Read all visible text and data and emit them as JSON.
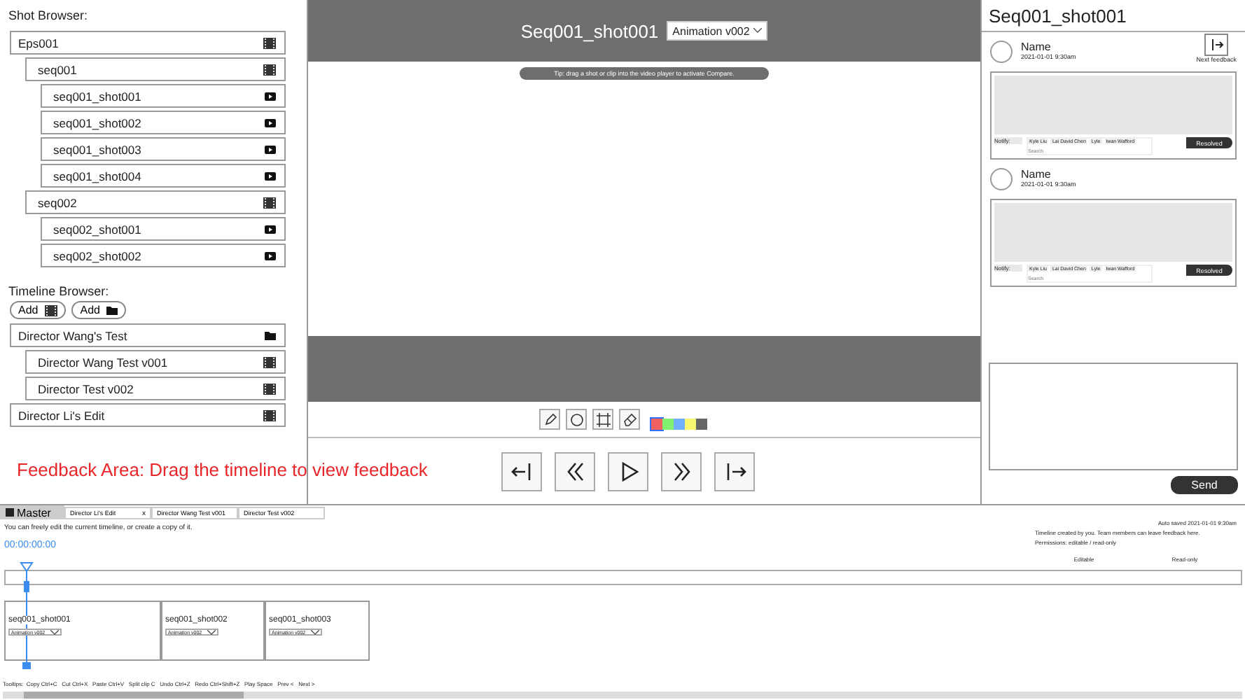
{
  "shot_browser": {
    "title": "Shot Browser:",
    "tree": [
      {
        "label": "Eps001",
        "kind": "sequence",
        "children": [
          {
            "label": "seq001",
            "kind": "sequence",
            "children": [
              {
                "label": "seq001_shot001",
                "kind": "shot"
              },
              {
                "label": "seq001_shot002",
                "kind": "shot"
              },
              {
                "label": "seq001_shot003",
                "kind": "shot"
              },
              {
                "label": "seq001_shot004",
                "kind": "shot"
              }
            ]
          },
          {
            "label": "seq002",
            "kind": "sequence",
            "children": [
              {
                "label": "seq002_shot001",
                "kind": "shot"
              },
              {
                "label": "seq002_shot002",
                "kind": "shot"
              }
            ]
          }
        ]
      }
    ]
  },
  "timeline_browser": {
    "title": "Timeline Browser:",
    "add_buttons": [
      {
        "label": "Add",
        "kind": "timeline"
      },
      {
        "label": "Add",
        "kind": "folder"
      }
    ],
    "tree": [
      {
        "label": "Director Wang's Test",
        "kind": "folder",
        "children": [
          {
            "label": "Director Wang Test v001",
            "kind": "sequence"
          },
          {
            "label": "Director Test v002",
            "kind": "sequence"
          }
        ]
      },
      {
        "label": "Director Li's Edit",
        "kind": "sequence"
      }
    ]
  },
  "feedback_hint": "Feedback Area: Drag the timeline to view feedback",
  "player": {
    "title": "Seq001_shot001",
    "version": "Animation v002",
    "tip": "Tip: drag a shot or clip into the video player to activate Compare.",
    "tools": [
      {
        "kind": "pencil"
      },
      {
        "kind": "circle"
      },
      {
        "kind": "rectangle"
      },
      {
        "kind": "eraser"
      }
    ],
    "colors": [
      {
        "color": "#f06060",
        "selected": true
      },
      {
        "color": "#80f070",
        "selected": false
      },
      {
        "color": "#70b0ff",
        "selected": false
      },
      {
        "color": "#f8f870",
        "selected": false
      },
      {
        "color": "#666666",
        "selected": false
      }
    ],
    "transport": [
      {
        "kind": "start"
      },
      {
        "kind": "rewind"
      },
      {
        "kind": "play"
      },
      {
        "kind": "forward"
      },
      {
        "kind": "end"
      }
    ]
  },
  "feedback": {
    "title": "Seq001_shot001",
    "next_label": "Next feedback",
    "comments": [
      {
        "name": "Name",
        "date": "2021-01-01 9:30am",
        "notify_label": "Notify:",
        "tags": [
          "Kyle Liu",
          "Lai David Chen",
          "Lyle",
          "Iwan Wafford"
        ],
        "search_placeholder": "Search",
        "resolve_label": "Resolved"
      },
      {
        "name": "Name",
        "date": "2021-01-01 9:30am",
        "notify_label": "Notify:",
        "tags": [
          "Kyle Liu",
          "Lai David Chen",
          "Lyle",
          "Iwan Wafford"
        ],
        "search_placeholder": "Search",
        "resolve_label": "Resolved"
      }
    ],
    "send_label": "Send"
  },
  "timeline": {
    "tabs": [
      {
        "label": "Master",
        "selected": true
      },
      {
        "label": "Director Li's Edit",
        "selected": false,
        "close": "x"
      },
      {
        "label": "Director Wang Test v001",
        "selected": false
      },
      {
        "label": "Director Test v002",
        "selected": false
      }
    ],
    "description": "You can freely edit the current timeline, or create a copy of it.",
    "timecode": "00:00:00:00",
    "autosave": "Auto saved 2021-01-01 9:30am",
    "info": [
      "Timeline created by you. Team members can leave feedback here.",
      "Permissions: editable / read-only"
    ],
    "permissions": [
      "Editable",
      "Read-only"
    ],
    "clips": [
      {
        "name": "seq001_shot001",
        "version": "Animation v002"
      },
      {
        "name": "seq001_shot002",
        "version": "Animation v002"
      },
      {
        "name": "seq001_shot003",
        "version": "Animation v002"
      }
    ],
    "tooltips": "Tooltips:  Copy Ctrl+C   Cut Ctrl+X   Paste Ctrl+V   Split clip C   Undo Ctrl+Z   Redo Ctrl+Shift+Z   Play Space   Prev <   Next >"
  }
}
